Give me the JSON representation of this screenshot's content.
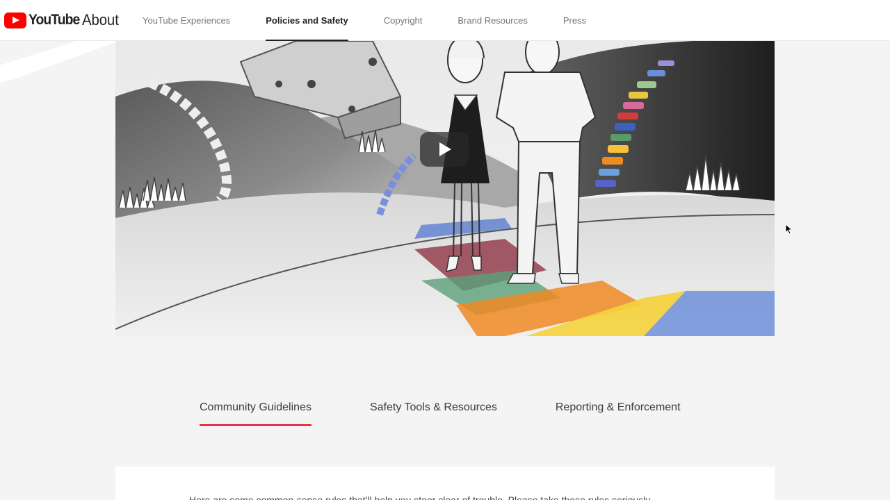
{
  "header": {
    "logo_wordmark": "YouTube",
    "logo_suffix": "About",
    "nav": [
      {
        "label": "YouTube Experiences",
        "active": false
      },
      {
        "label": "Policies and Safety",
        "active": true
      },
      {
        "label": "Copyright",
        "active": false
      },
      {
        "label": "Brand Resources",
        "active": false
      },
      {
        "label": "Press",
        "active": false
      }
    ]
  },
  "hero": {
    "video": "play-icon"
  },
  "tabs": [
    {
      "label": "Community Guidelines",
      "active": true
    },
    {
      "label": "Safety Tools & Resources",
      "active": false
    },
    {
      "label": "Reporting & Enforcement",
      "active": false
    }
  ],
  "content": {
    "intro": "Here are some common-sense rules that'll help you steer clear of trouble. Please take these rules seriously."
  },
  "colors": {
    "brand_red": "#ff0000",
    "tab_underline": "#e0001b",
    "background": "#f4f4f4"
  }
}
